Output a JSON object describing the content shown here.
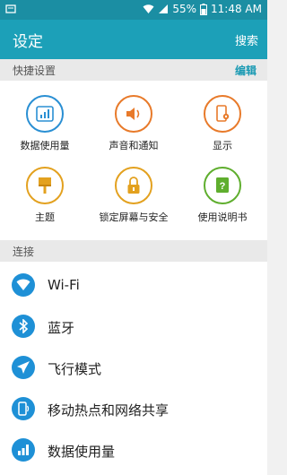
{
  "status_bar": {
    "battery_percent": "55%",
    "time": "11:48 AM"
  },
  "app_bar": {
    "title": "设定",
    "search_label": "搜索"
  },
  "quick_settings": {
    "header": "快捷设置",
    "edit_label": "编辑",
    "items": [
      {
        "label": "数据使用量",
        "icon": "data-usage-icon",
        "color": "#2a8fd3"
      },
      {
        "label": "声音和通知",
        "icon": "speaker-icon",
        "color": "#e87a2a"
      },
      {
        "label": "显示",
        "icon": "display-settings-icon",
        "color": "#e87a2a"
      },
      {
        "label": "主题",
        "icon": "paint-brush-icon",
        "color": "#e3a11f"
      },
      {
        "label": "锁定屏幕与安全",
        "icon": "lock-icon",
        "color": "#e3a11f"
      },
      {
        "label": "使用说明书",
        "icon": "help-book-icon",
        "color": "#5fae2e"
      }
    ]
  },
  "connections": {
    "header": "连接",
    "items": [
      {
        "label": "Wi-Fi",
        "icon": "wifi-icon"
      },
      {
        "label": "蓝牙",
        "icon": "bluetooth-icon"
      },
      {
        "label": "飞行模式",
        "icon": "airplane-icon"
      },
      {
        "label": "移动热点和网络共享",
        "icon": "hotspot-icon"
      },
      {
        "label": "数据使用量",
        "icon": "data-usage-icon"
      }
    ]
  }
}
